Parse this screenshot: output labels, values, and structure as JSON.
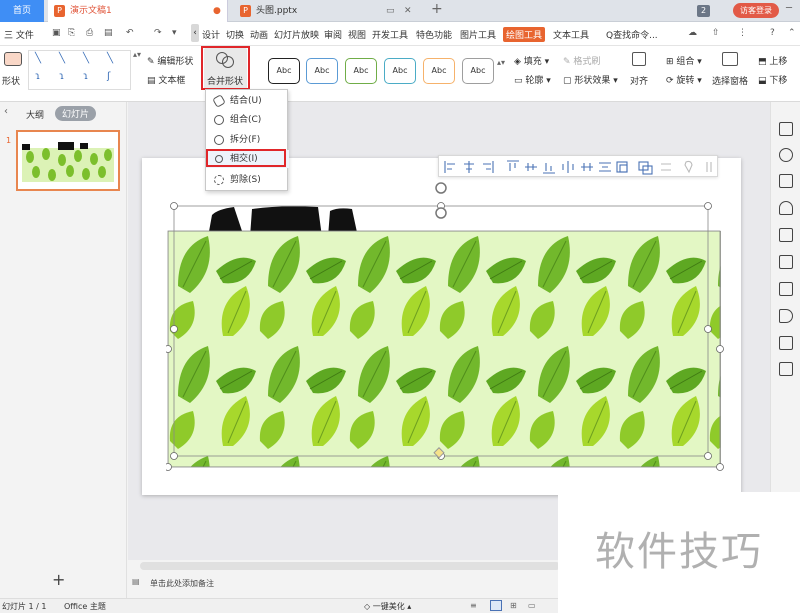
{
  "tabs": {
    "home": "首页",
    "doc": "演示文稿1",
    "ppt": "头图.pptx",
    "badge": "2",
    "login": "访客登录"
  },
  "menubar": {
    "file": "三 文件",
    "items": [
      "设计",
      "切换",
      "动画",
      "幻灯片放映",
      "审阅",
      "视图",
      "开发工具",
      "特色功能",
      "图片工具",
      "绘图工具",
      "文本工具"
    ],
    "search": "Q查找命令..."
  },
  "ribbon": {
    "shape_label": "形状",
    "edit_shape": "编辑形状",
    "textbox": "文本框",
    "merge_shape": "合并形状",
    "abc": [
      "Abc",
      "Abc",
      "Abc",
      "Abc",
      "Abc",
      "Abc"
    ],
    "fill": "填充",
    "format_brush": "格式刷",
    "outline": "轮廓",
    "shape_effect": "形状效果",
    "align": "对齐",
    "group": "组合",
    "rotate": "旋转",
    "select_pane": "选择窗格",
    "move_up": "上移",
    "move_down": "下移"
  },
  "dropdown": {
    "items": [
      "结合(U)",
      "组合(C)",
      "拆分(F)",
      "相交(I)",
      "剪除(S)"
    ],
    "highlighted": "相交(I)"
  },
  "leftpanel": {
    "outline": "大纲",
    "slides": "幻灯片",
    "slide_number": "1",
    "add": "+"
  },
  "notes": "单击此处添加备注",
  "statusbar": {
    "slide": "幻灯片 1 / 1",
    "theme": "Office 主题",
    "beautify": "一键美化"
  },
  "watermark": "软件技巧",
  "colors": {
    "accent": "#e8642f",
    "highlight_box": "#e0262a",
    "leaf_bg": "#e3f7c4",
    "leaf_green": "#6fb52a"
  }
}
